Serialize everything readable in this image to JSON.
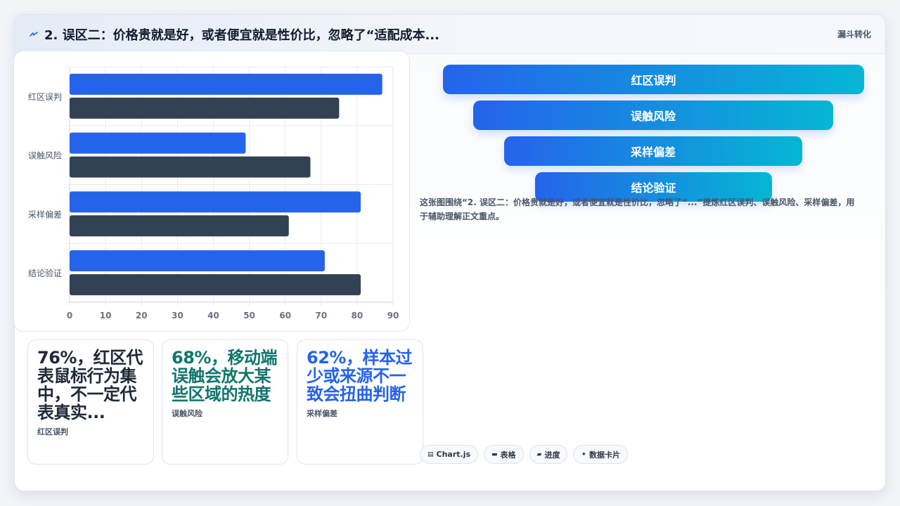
{
  "header": {
    "title": "2. 误区二：价格贵就是好，或者便宜就是性价比，忽略了“适配成本...",
    "tag": "漏斗转化"
  },
  "chart_data": {
    "type": "bar",
    "orientation": "horizontal",
    "categories": [
      "红区误判",
      "误触风险",
      "采样偏差",
      "结论验证"
    ],
    "series": [
      {
        "values": [
          87,
          49,
          81,
          71
        ],
        "color": "#2563eb"
      },
      {
        "values": [
          75,
          67,
          61,
          81
        ],
        "color": "#334155"
      }
    ],
    "xlim": [
      0,
      90
    ],
    "xticks": [
      "0",
      "10",
      "20",
      "30",
      "40",
      "50",
      "60",
      "70",
      "80",
      "90"
    ],
    "grid": true
  },
  "stats": [
    {
      "big": "76%，红区代表鼠标行为集中，不一定代表真实...",
      "small": "红区误判",
      "color": "#1f2937"
    },
    {
      "big": "68%，移动端误触会放大某些区域的热度",
      "small": "误触风险",
      "color": "#0f766e"
    },
    {
      "big": "62%，样本过少或来源不一致会扭曲判断",
      "small": "采样偏差",
      "color": "#2563eb"
    }
  ],
  "funnel": [
    "红区误判",
    "误触风险",
    "采样偏差",
    "结论验证"
  ],
  "description": "这张图围绕“2. 误区二：价格贵就是好，或者便宜就是性价比，忽略了“...”提炼红区误判、误触风险、采样偏差，用于辅助理解正文重点。",
  "chips": [
    {
      "icon": "chart-icon",
      "glyph": "▤",
      "label": "Chart.js"
    },
    {
      "icon": "table-icon",
      "glyph": "▬",
      "label": "表格"
    },
    {
      "icon": "progress-icon",
      "glyph": "▰",
      "label": "进度"
    },
    {
      "icon": "sparkle-icon",
      "glyph": "✦",
      "label": "数据卡片"
    }
  ],
  "colors": {
    "accent": "#2563eb",
    "dark_bar": "#334155",
    "teal": "#0f766e",
    "funnel_end": "#06b6d4"
  }
}
